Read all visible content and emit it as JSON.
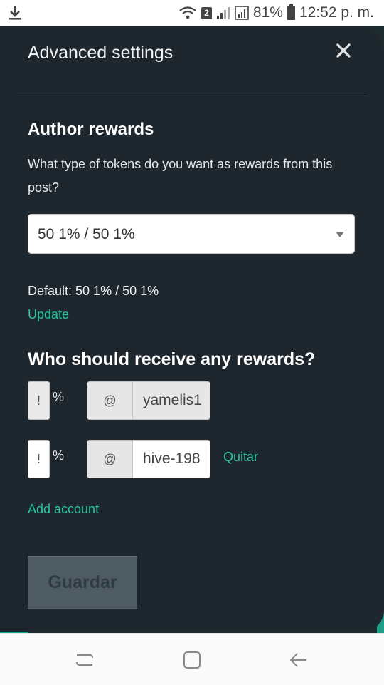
{
  "status_bar": {
    "notification_badge": "2",
    "battery": "81%",
    "time": "12:52 p. m."
  },
  "modal": {
    "title": "Advanced settings",
    "close_icon": "close-icon"
  },
  "author_rewards": {
    "heading": "Author rewards",
    "description": "What type of tokens do you want as rewards from this post?",
    "selected_option": "50 1% / 50 1%",
    "default_text": "Default: 50 1% / 50 1%",
    "update_label": "Update"
  },
  "beneficiaries": {
    "heading": "Who should receive any rewards?",
    "rows": [
      {
        "percent": "!",
        "percent_sign": "%",
        "at": "@",
        "account": "yamelis1",
        "remove_label": ""
      },
      {
        "percent": "!",
        "percent_sign": "%",
        "at": "@",
        "account": "hive-198",
        "remove_label": "Quitar"
      }
    ],
    "add_label": "Add account"
  },
  "save_label": "Guardar",
  "colors": {
    "modal_bg": "#1f272e",
    "accent": "#29c4a1",
    "save_disabled": "#4f5b63"
  }
}
